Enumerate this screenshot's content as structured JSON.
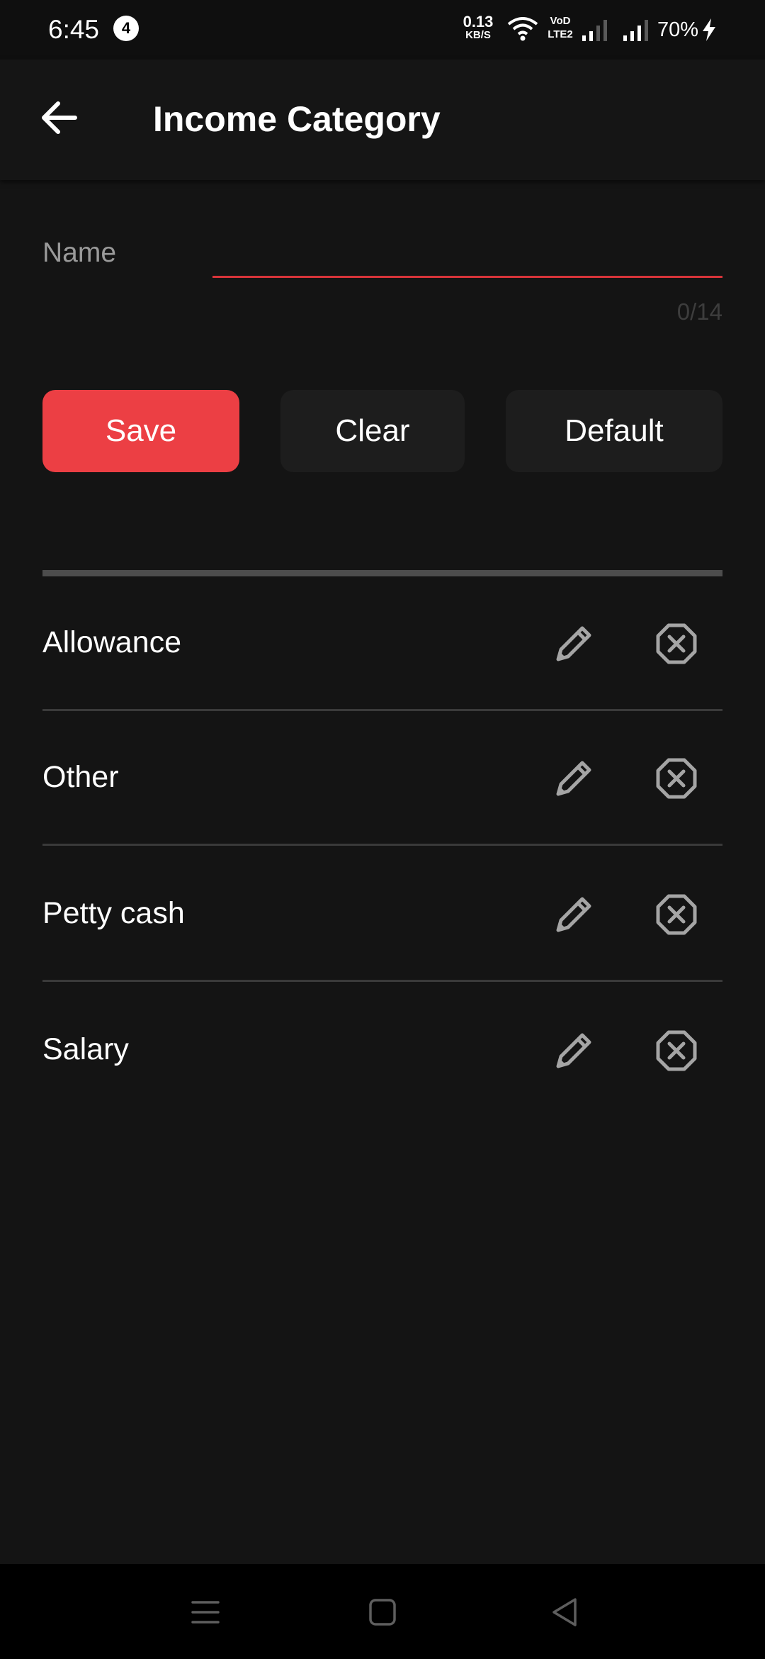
{
  "status_bar": {
    "time": "6:45",
    "notification_count": "4",
    "net_speed_value": "0.13",
    "net_speed_unit": "KB/S",
    "volte_top": "VoD",
    "volte_bottom": "LTE2",
    "battery": "70%",
    "icons": [
      "wifi-icon",
      "signal-icon",
      "signal-icon",
      "bolt-icon"
    ]
  },
  "app_bar": {
    "title": "Income Category",
    "back_icon": "arrow-left-icon"
  },
  "form": {
    "name_label": "Name",
    "name_value": "",
    "char_counter": "0/14",
    "accent_color": "#ec3f44"
  },
  "buttons": {
    "save": "Save",
    "clear": "Clear",
    "default": "Default"
  },
  "categories": [
    {
      "label": "Allowance"
    },
    {
      "label": "Other"
    },
    {
      "label": "Petty cash"
    },
    {
      "label": "Salary"
    }
  ],
  "row_icons": {
    "edit": "pencil-icon",
    "delete": "close-octagon-icon"
  },
  "nav_bar": {
    "icons": [
      "menu-icon",
      "home-icon",
      "back-triangle-icon"
    ]
  }
}
